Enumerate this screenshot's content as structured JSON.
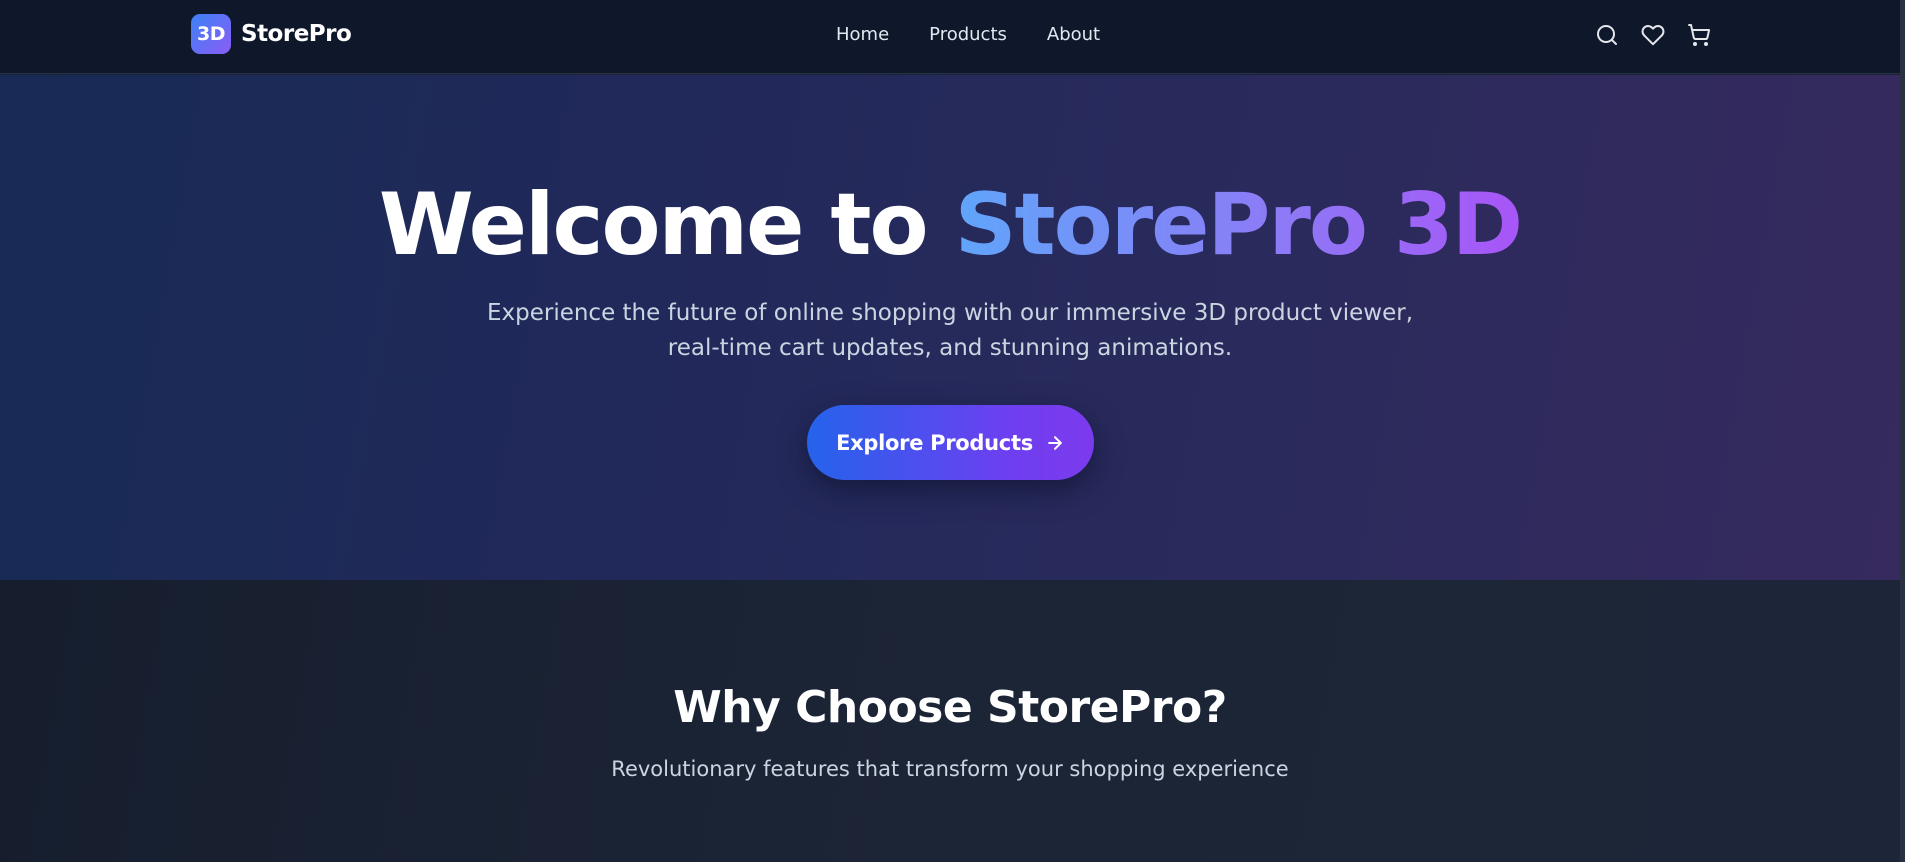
{
  "navbar": {
    "logo_text": "3D",
    "brand_name": "StorePro",
    "links": [
      {
        "label": "Home"
      },
      {
        "label": "Products"
      },
      {
        "label": "About"
      }
    ],
    "icons": [
      "search-icon",
      "heart-icon",
      "cart-icon"
    ]
  },
  "hero": {
    "title_prefix": "Welcome to ",
    "title_accent": "StorePro 3D",
    "subtitle": "Experience the future of online shopping with our immersive 3D product viewer, real-time cart updates, and stunning animations.",
    "cta_label": "Explore Products",
    "cta_icon": "arrow-right-icon"
  },
  "features": {
    "title": "Why Choose StorePro?",
    "subtitle": "Revolutionary features that transform your shopping experience"
  },
  "colors": {
    "accent_blue": "#3b82f6",
    "accent_purple": "#8b5cf6",
    "nav_bg": "#0f172a"
  }
}
